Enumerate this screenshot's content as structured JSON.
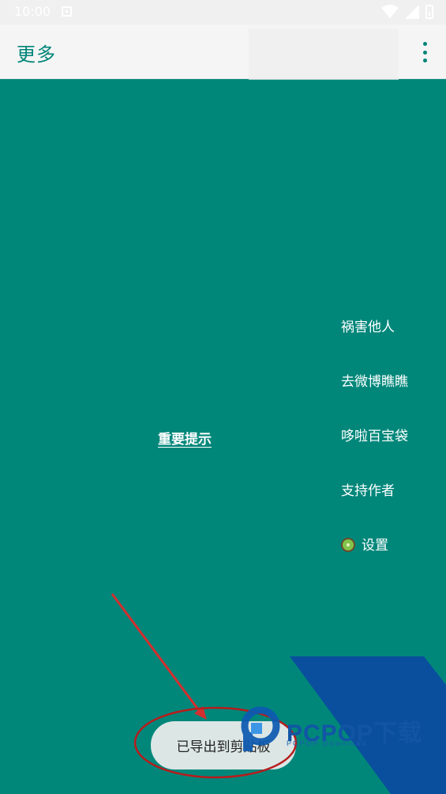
{
  "status_bar": {
    "time": "10:00"
  },
  "app_bar": {
    "title": "更多"
  },
  "menu": {
    "items": [
      {
        "label": "祸害他人"
      },
      {
        "label": "去微博瞧瞧"
      },
      {
        "label": "哆啦百宝袋"
      },
      {
        "label": "支持作者"
      },
      {
        "label": "设置",
        "icon": "kiwi-icon"
      }
    ]
  },
  "main": {
    "important_link": "重要提示"
  },
  "toast": {
    "message": "已导出到剪贴板"
  },
  "watermark": {
    "brand": "PCPOP下载",
    "sub": "PCPOP Download"
  },
  "colors": {
    "background": "#00877a",
    "app_bar": "#f5f5f5",
    "accent": "#008579",
    "annotation_red": "#d32f2f",
    "watermark_blue": "#0a4f9e"
  }
}
